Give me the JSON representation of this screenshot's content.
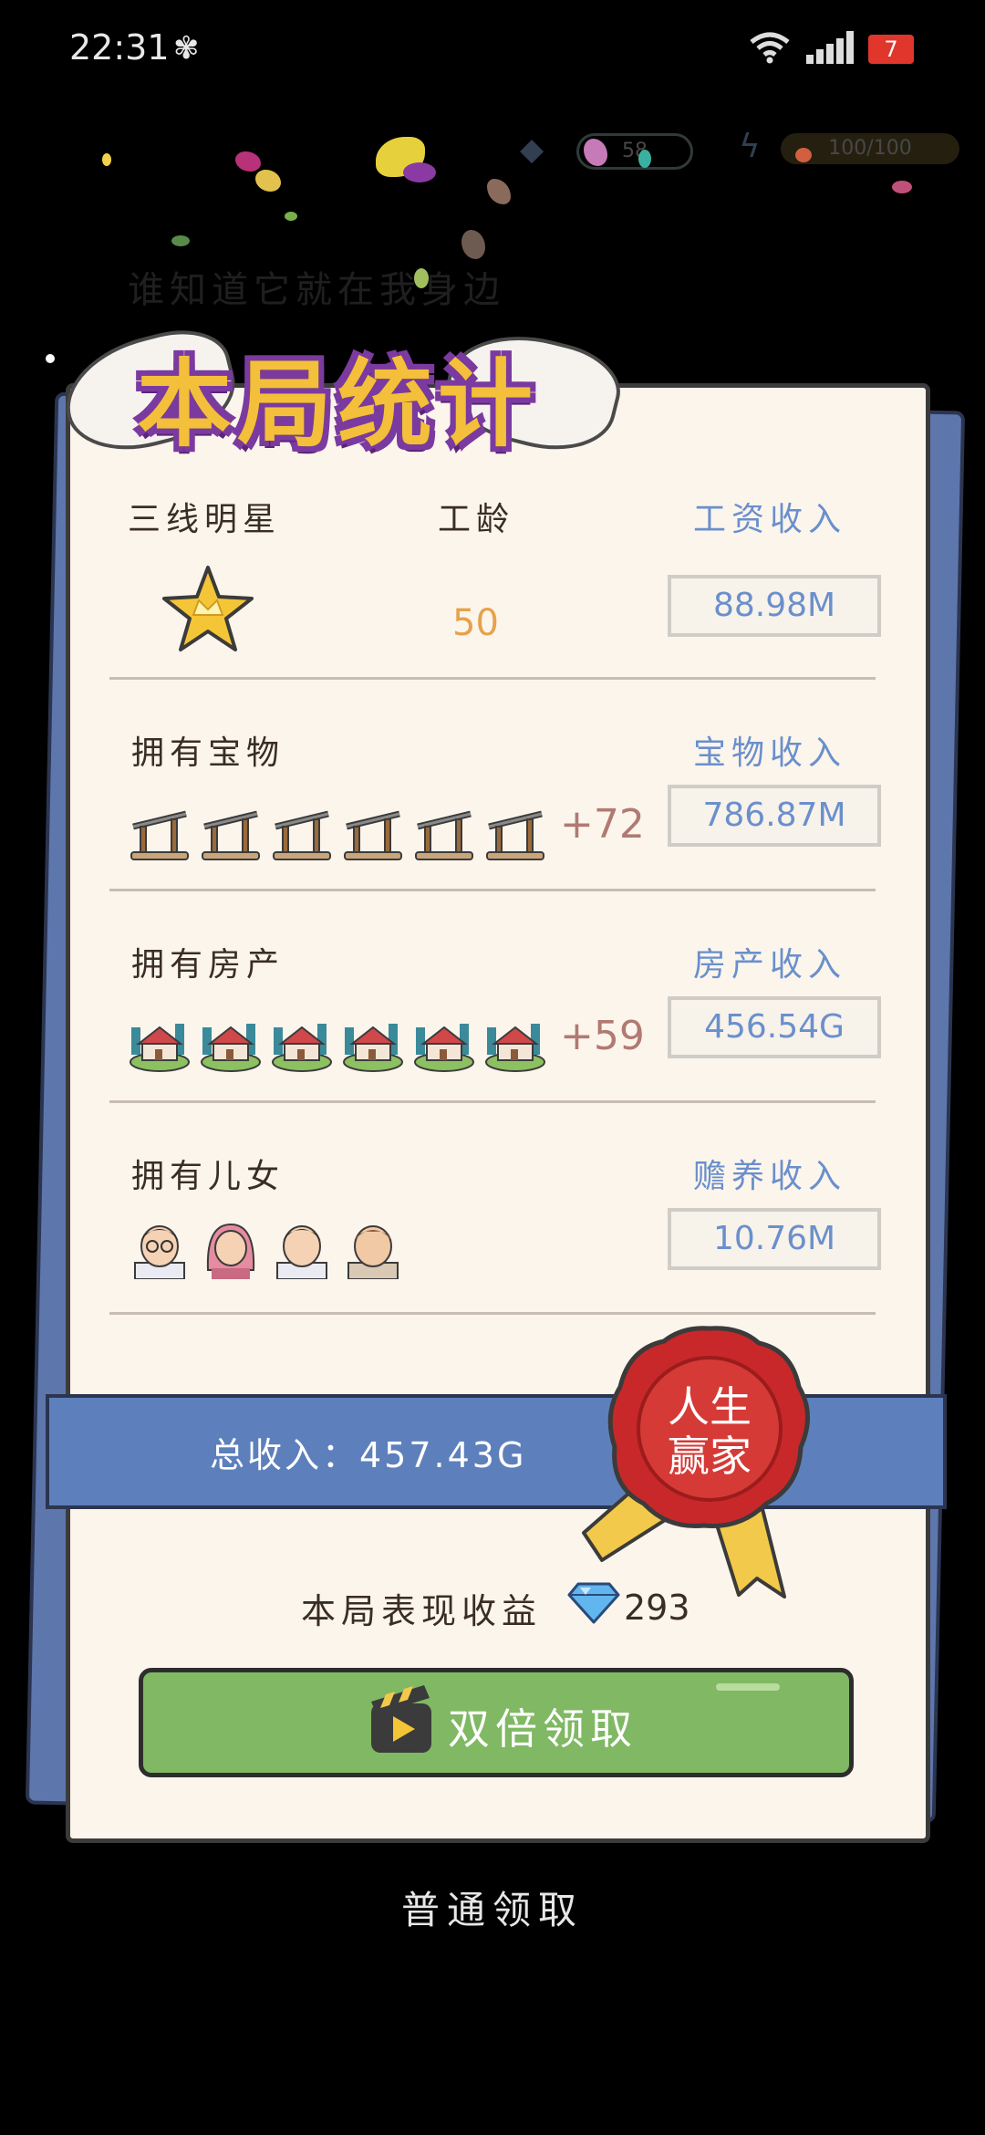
{
  "status_bar": {
    "time": "22:31",
    "battery": "7"
  },
  "background_hud": {
    "gems": "58",
    "energy": "100/100",
    "faded_text": "谁知道它就在我身边"
  },
  "title": "本局统计",
  "rows": {
    "rank": {
      "label": "三线明星",
      "icon": "crown-star-icon"
    },
    "work_age": {
      "label": "工龄",
      "value": "50"
    },
    "salary": {
      "label": "工资收入",
      "value": "88.98M"
    },
    "treasure": {
      "label": "拥有宝物",
      "extra": "+72",
      "income_label": "宝物收入",
      "income": "786.87M",
      "icon": "ancient-gate-icon"
    },
    "property": {
      "label": "拥有房产",
      "extra": "+59",
      "income_label": "房产收入",
      "income": "456.54G",
      "icon": "house-island-icon"
    },
    "children": {
      "label": "拥有儿女",
      "income_label": "赡养收入",
      "income": "10.76M"
    }
  },
  "total": {
    "text": "总收入：457.43G"
  },
  "seal": {
    "line1": "人生",
    "line2": "赢家"
  },
  "performance": {
    "label": "本局表现收益",
    "value": "293"
  },
  "buttons": {
    "double": "双倍领取",
    "normal": "普通领取"
  },
  "colors": {
    "income_blue": "#6a8fcc",
    "button_green": "#80b864",
    "total_bar": "#5d80bc",
    "seal_red": "#c8282a",
    "title_gold": "#f4bf3a"
  }
}
